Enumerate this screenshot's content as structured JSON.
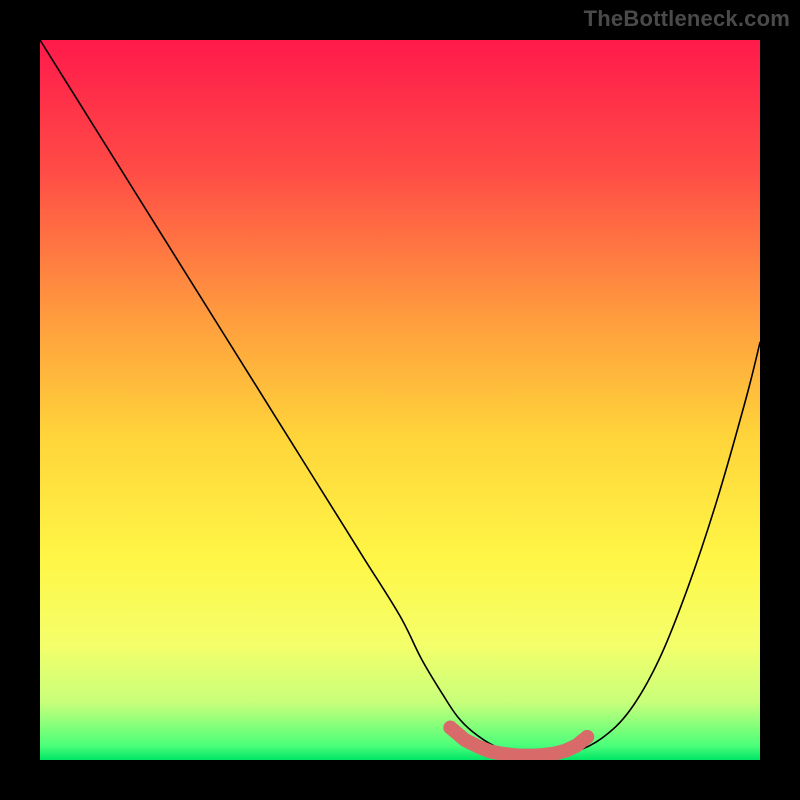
{
  "watermark": "TheBottleneck.com",
  "chart_data": {
    "type": "line",
    "title": "",
    "xlabel": "",
    "ylabel": "",
    "xlim": [
      0,
      100
    ],
    "ylim": [
      0,
      100
    ],
    "grid": false,
    "legend": false,
    "background_gradient": {
      "stops": [
        {
          "offset": 0.0,
          "color": "#ff1a4b"
        },
        {
          "offset": 0.18,
          "color": "#ff4b46"
        },
        {
          "offset": 0.38,
          "color": "#ff9a3e"
        },
        {
          "offset": 0.55,
          "color": "#ffd43a"
        },
        {
          "offset": 0.72,
          "color": "#fff646"
        },
        {
          "offset": 0.84,
          "color": "#f4ff6a"
        },
        {
          "offset": 0.92,
          "color": "#c8ff7a"
        },
        {
          "offset": 0.98,
          "color": "#4cff7a"
        },
        {
          "offset": 1.0,
          "color": "#00e566"
        }
      ]
    },
    "series": [
      {
        "name": "curve",
        "stroke": "#000000",
        "stroke_width": 1.6,
        "x": [
          0,
          5,
          10,
          15,
          20,
          25,
          30,
          35,
          40,
          45,
          50,
          53,
          56,
          58,
          60,
          63,
          66,
          69,
          72,
          74,
          78,
          82,
          86,
          90,
          94,
          98,
          100
        ],
        "y": [
          100,
          92,
          84,
          76,
          68,
          60,
          52,
          44,
          36,
          28,
          20,
          14,
          9,
          6,
          4,
          2,
          1,
          0.5,
          0.5,
          1,
          3,
          7,
          14,
          24,
          36,
          50,
          58
        ]
      },
      {
        "name": "marker-dots",
        "type": "scatter",
        "color": "#d86a6a",
        "radius": 7,
        "x": [
          57,
          59,
          61,
          62.5,
          64,
          65.5,
          67,
          68.5,
          70,
          71.5,
          73,
          74.5,
          76
        ],
        "y": [
          4.5,
          2.8,
          1.8,
          1.2,
          0.9,
          0.7,
          0.6,
          0.6,
          0.7,
          0.9,
          1.3,
          2.0,
          3.2
        ]
      }
    ]
  }
}
